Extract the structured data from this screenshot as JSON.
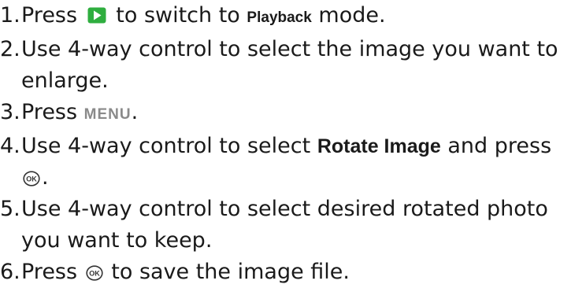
{
  "steps": [
    {
      "number": "1.",
      "text_before": "Press",
      "icon": "playback-button-icon",
      "text_after": "to switch to",
      "mode_label": "Playback",
      "text_end": "mode."
    },
    {
      "number": "2.",
      "line1": "Use 4-way control to select the image you want to",
      "line2": "enlarge."
    },
    {
      "number": "3.",
      "text_before": "Press",
      "key_label": "MENU",
      "text_after": "."
    },
    {
      "number": "4.",
      "text_before": "Use 4-way control to select",
      "menu_item": "Rotate Image",
      "text_after": "and press",
      "icon": "ok-button-icon",
      "line2_after": "."
    },
    {
      "number": "5.",
      "line1": "Use 4-way control to select desired rotated photo",
      "line2": "you want to keep."
    },
    {
      "number": "6.",
      "text_before": "Press",
      "icon": "ok-button-icon",
      "text_after": "to save the image file."
    }
  ],
  "colors": {
    "playback_icon_green": "#2fae3f",
    "menu_key_gray": "#8a8a8a",
    "text": "#1a1a1a"
  }
}
